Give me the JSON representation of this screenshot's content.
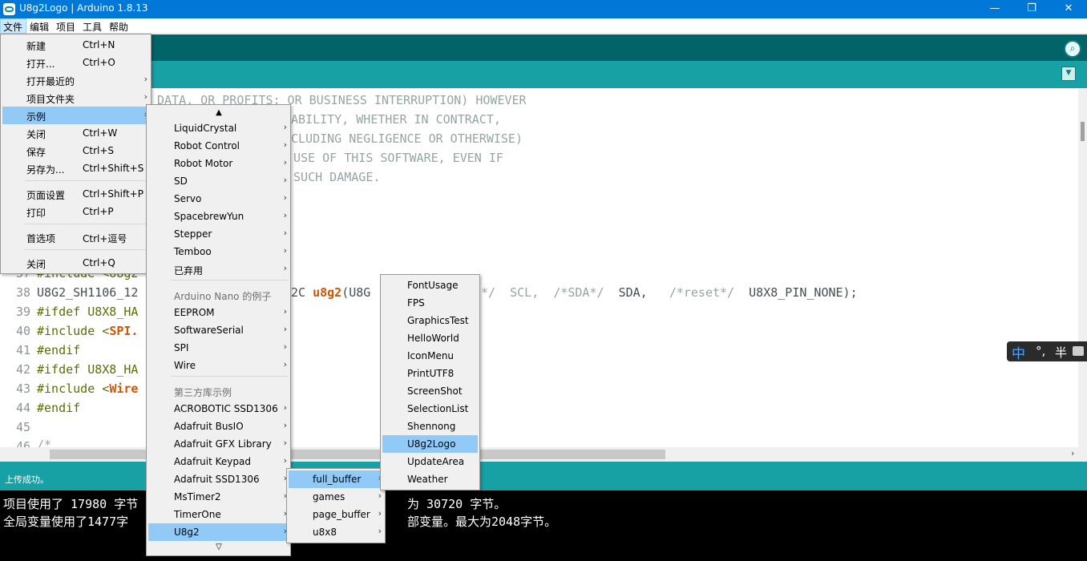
{
  "window": {
    "title": "U8g2Logo | Arduino 1.8.13",
    "minimize": "—",
    "maximize": "❐",
    "close": "✕"
  },
  "menubar": [
    "文件",
    "编辑",
    "项目",
    "工具",
    "帮助"
  ],
  "file_menu": [
    {
      "label": "新建",
      "shortcut": "Ctrl+N"
    },
    {
      "label": "打开...",
      "shortcut": "Ctrl+O"
    },
    {
      "label": "打开最近的",
      "shortcut": "",
      "submenu": true
    },
    {
      "label": "项目文件夹",
      "shortcut": "",
      "submenu": true
    },
    {
      "label": "示例",
      "shortcut": "",
      "submenu": true,
      "selected": true
    },
    {
      "label": "关闭",
      "shortcut": "Ctrl+W"
    },
    {
      "label": "保存",
      "shortcut": "Ctrl+S"
    },
    {
      "label": "另存为...",
      "shortcut": "Ctrl+Shift+S"
    },
    {
      "label": "页面设置",
      "shortcut": "Ctrl+Shift+P"
    },
    {
      "label": "打印",
      "shortcut": "Ctrl+P"
    },
    {
      "label": "首选项",
      "shortcut": "Ctrl+逗号"
    },
    {
      "label": "关闭",
      "shortcut": "Ctrl+Q"
    }
  ],
  "examples_menu": {
    "scroll_up": "▲",
    "scroll_down": "▽",
    "items": [
      {
        "label": "LiquidCrystal",
        "submenu": true
      },
      {
        "label": "Robot Control",
        "submenu": true
      },
      {
        "label": "Robot Motor",
        "submenu": true
      },
      {
        "label": "SD",
        "submenu": true
      },
      {
        "label": "Servo",
        "submenu": true
      },
      {
        "label": "SpacebrewYun",
        "submenu": true
      },
      {
        "label": "Stepper",
        "submenu": true
      },
      {
        "label": "Temboo",
        "submenu": true
      },
      {
        "label": "已弃用",
        "submenu": true
      },
      {
        "label": "Arduino Nano 的例子",
        "header": true
      },
      {
        "label": "EEPROM",
        "submenu": true
      },
      {
        "label": "SoftwareSerial",
        "submenu": true
      },
      {
        "label": "SPI",
        "submenu": true
      },
      {
        "label": "Wire",
        "submenu": true
      },
      {
        "label": "第三方库示例",
        "header": true
      },
      {
        "label": "ACROBOTIC SSD1306",
        "submenu": true
      },
      {
        "label": "Adafruit BusIO",
        "submenu": true
      },
      {
        "label": "Adafruit GFX Library",
        "submenu": true
      },
      {
        "label": "Adafruit Keypad",
        "submenu": true
      },
      {
        "label": "Adafruit SSD1306",
        "submenu": true
      },
      {
        "label": "MsTimer2",
        "submenu": true
      },
      {
        "label": "TimerOne",
        "submenu": true
      },
      {
        "label": "U8g2",
        "submenu": true,
        "selected": true
      }
    ]
  },
  "u8g2_menu": [
    {
      "label": "full_buffer",
      "selected": true
    },
    {
      "label": "games"
    },
    {
      "label": "page_buffer"
    },
    {
      "label": "u8x8"
    }
  ],
  "full_buffer_menu": [
    {
      "label": "FontUsage"
    },
    {
      "label": "FPS"
    },
    {
      "label": "GraphicsTest"
    },
    {
      "label": "HelloWorld"
    },
    {
      "label": "IconMenu"
    },
    {
      "label": "PrintUTF8"
    },
    {
      "label": "ScreenShot"
    },
    {
      "label": "SelectionList"
    },
    {
      "label": "Shennong"
    },
    {
      "label": "U8g2Logo",
      "selected": true
    },
    {
      "label": "UpdateArea"
    },
    {
      "label": "Weather"
    }
  ],
  "editor": {
    "comment_lines": [
      "DATA, OR PROFITS; OR BUSINESS INTERRUPTION) HOWEVER",
      "ABILITY, WHETHER IN CONTRACT,",
      "CLUDING NEGLIGENCE OR OTHERWISE)",
      " USE OF THIS SOFTWARE, EVEN IF",
      " SUCH DAMAGE."
    ],
    "line_numbers": [
      "37",
      "38",
      "39",
      "40",
      "41",
      "42",
      "43",
      "44",
      "45",
      "46"
    ],
    "lines": {
      "l37": "#include <U8g2",
      "l38a": "U8G2_SH1106_12",
      "l38b": "2C ",
      "l38fn": "u8g2",
      "l38c": "(U8G",
      "l38d": "*/  SCL,  ",
      "l38e": "/*SDA*/",
      "l38f": "  SDA,   ",
      "l38g": "/*reset*/",
      "l38h": "  U8X8_PIN_NONE);",
      "l39": "#ifdef U8X8_HA",
      "l40a": "#include <",
      "l40b": "SPI.",
      "l41": "#endif",
      "l42": "#ifdef U8X8_HA",
      "l43a": "#include <",
      "l43b": "Wire",
      "l44": "#endif",
      "l46": "/*"
    }
  },
  "status": {
    "message": "上传成功。"
  },
  "console": [
    "项目使用了 17980 字节",
    "为 30720 字节。",
    "全局变量使用了1477字",
    "部变量。最大为2048字节。"
  ],
  "ime": {
    "mode": "中",
    "punct": "°,",
    "width": "半",
    "icon": "shirt-icon"
  },
  "colors": {
    "titlebar": "#0078d7",
    "toolbar": "#006468",
    "tabbar": "#17a1a5",
    "menu_selected": "#91c9f7",
    "keyword": "#d35400"
  }
}
